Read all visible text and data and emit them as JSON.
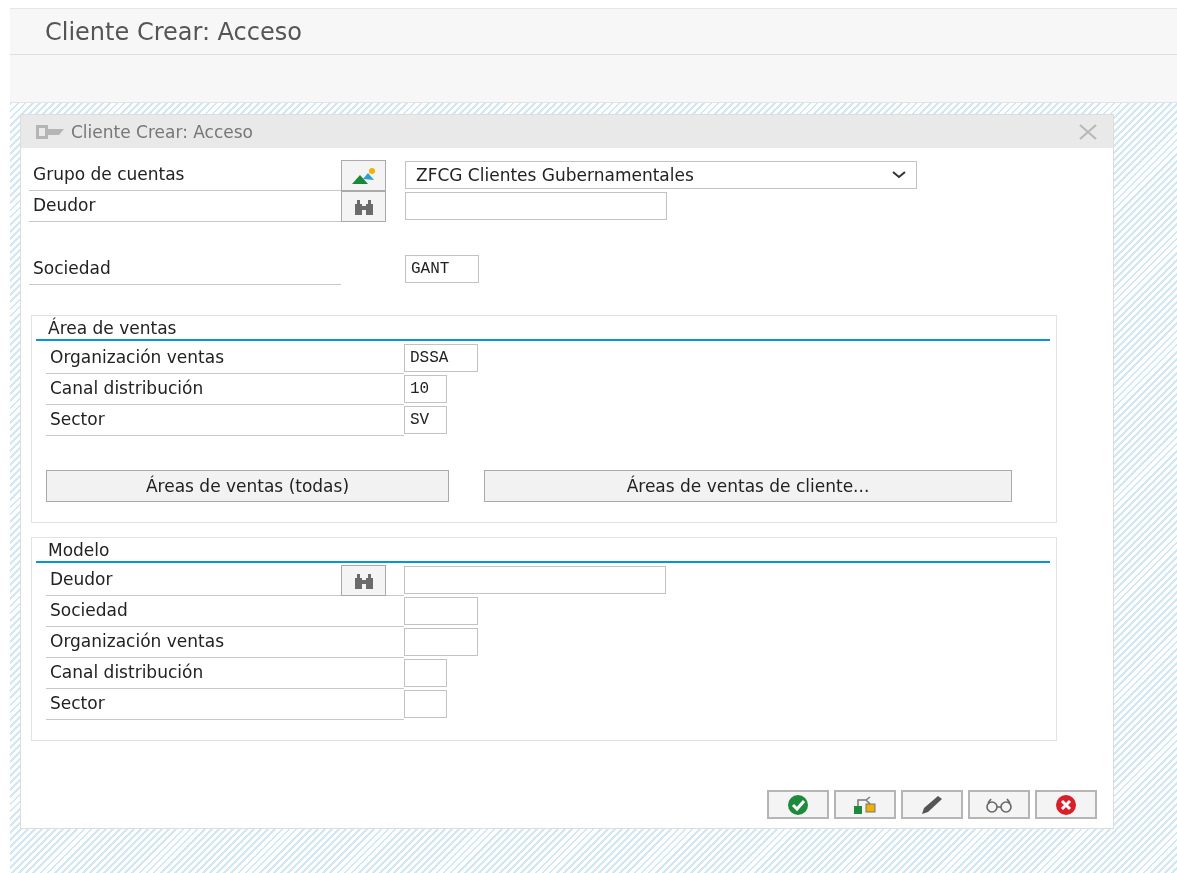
{
  "window": {
    "title": "Cliente Crear: Acceso"
  },
  "dialog": {
    "title": "Cliente Crear: Acceso",
    "fields": [
      {
        "label": "Grupo de cuentas",
        "kind": "dropdown",
        "value": "ZFCG Clientes Gubernamentales"
      },
      {
        "label": "Deudor",
        "kind": "lookup"
      },
      {
        "label": "Sociedad",
        "kind": "code",
        "value": "GANT"
      }
    ],
    "groups": [
      {
        "title": "Área de ventas",
        "fields": [
          {
            "label": "Organización ventas",
            "kind": "code",
            "value": "DSSA"
          },
          {
            "label": "Canal distribución",
            "kind": "short-code",
            "value": "10"
          },
          {
            "label": "Sector",
            "kind": "short-code",
            "value": "SV"
          }
        ],
        "buttons": [
          "Áreas de ventas (todas)",
          "Áreas de ventas de cliente..."
        ]
      },
      {
        "title": "Modelo",
        "fields": [
          {
            "label": "Deudor",
            "kind": "lookup"
          },
          {
            "label": "Sociedad",
            "kind": "code"
          },
          {
            "label": "Organización ventas",
            "kind": "code"
          },
          {
            "label": "Canal distribución",
            "kind": "short-code"
          },
          {
            "label": "Sector",
            "kind": "short-code"
          }
        ]
      }
    ],
    "footer_buttons": [
      {
        "kind": "confirm"
      },
      {
        "kind": "hierarchy"
      },
      {
        "kind": "edit"
      },
      {
        "kind": "display"
      },
      {
        "kind": "cancel"
      }
    ]
  }
}
